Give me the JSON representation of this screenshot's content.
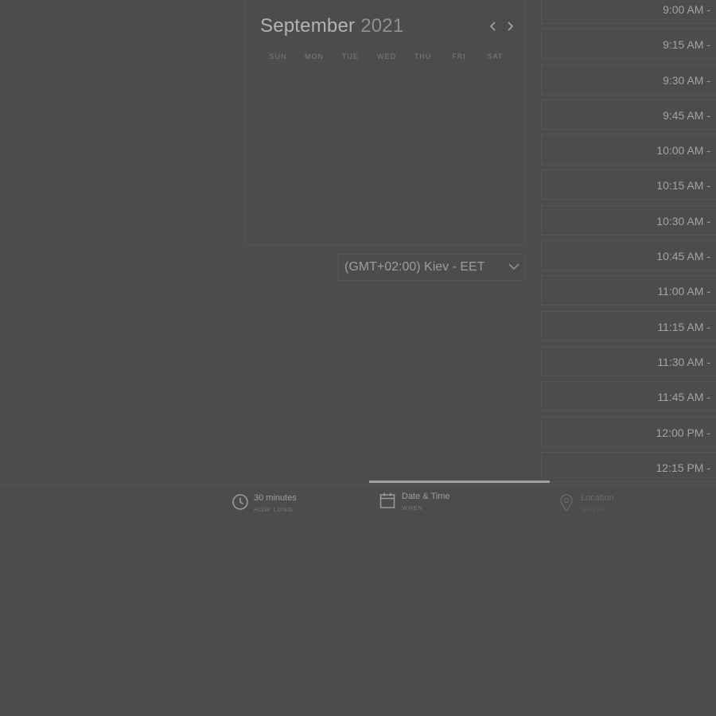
{
  "calendar": {
    "month": "September",
    "year": "2021",
    "weekdays": [
      "SUN",
      "MON",
      "TUE",
      "WED",
      "THU",
      "FRI",
      "SAT"
    ]
  },
  "timezone": {
    "label": "(GMT+02:00) Kiev - EET"
  },
  "time_slots": [
    "9:00 AM -",
    "9:15 AM -",
    "9:30 AM -",
    "9:45 AM -",
    "10:00 AM -",
    "10:15 AM -",
    "10:30 AM -",
    "10:45 AM -",
    "11:00 AM -",
    "11:15 AM -",
    "11:30 AM -",
    "11:45 AM -",
    "12:00 PM -",
    "12:15 PM -"
  ],
  "steps": [
    {
      "title": "30 minutes",
      "subtitle": "HOW LONG",
      "icon": "clock-icon"
    },
    {
      "title": "Date & Time",
      "subtitle": "WHEN",
      "icon": "calendar-icon"
    },
    {
      "title": "Location",
      "subtitle": "WHERE",
      "icon": "location-pin-icon"
    }
  ],
  "progress": {
    "active_step": 2
  }
}
